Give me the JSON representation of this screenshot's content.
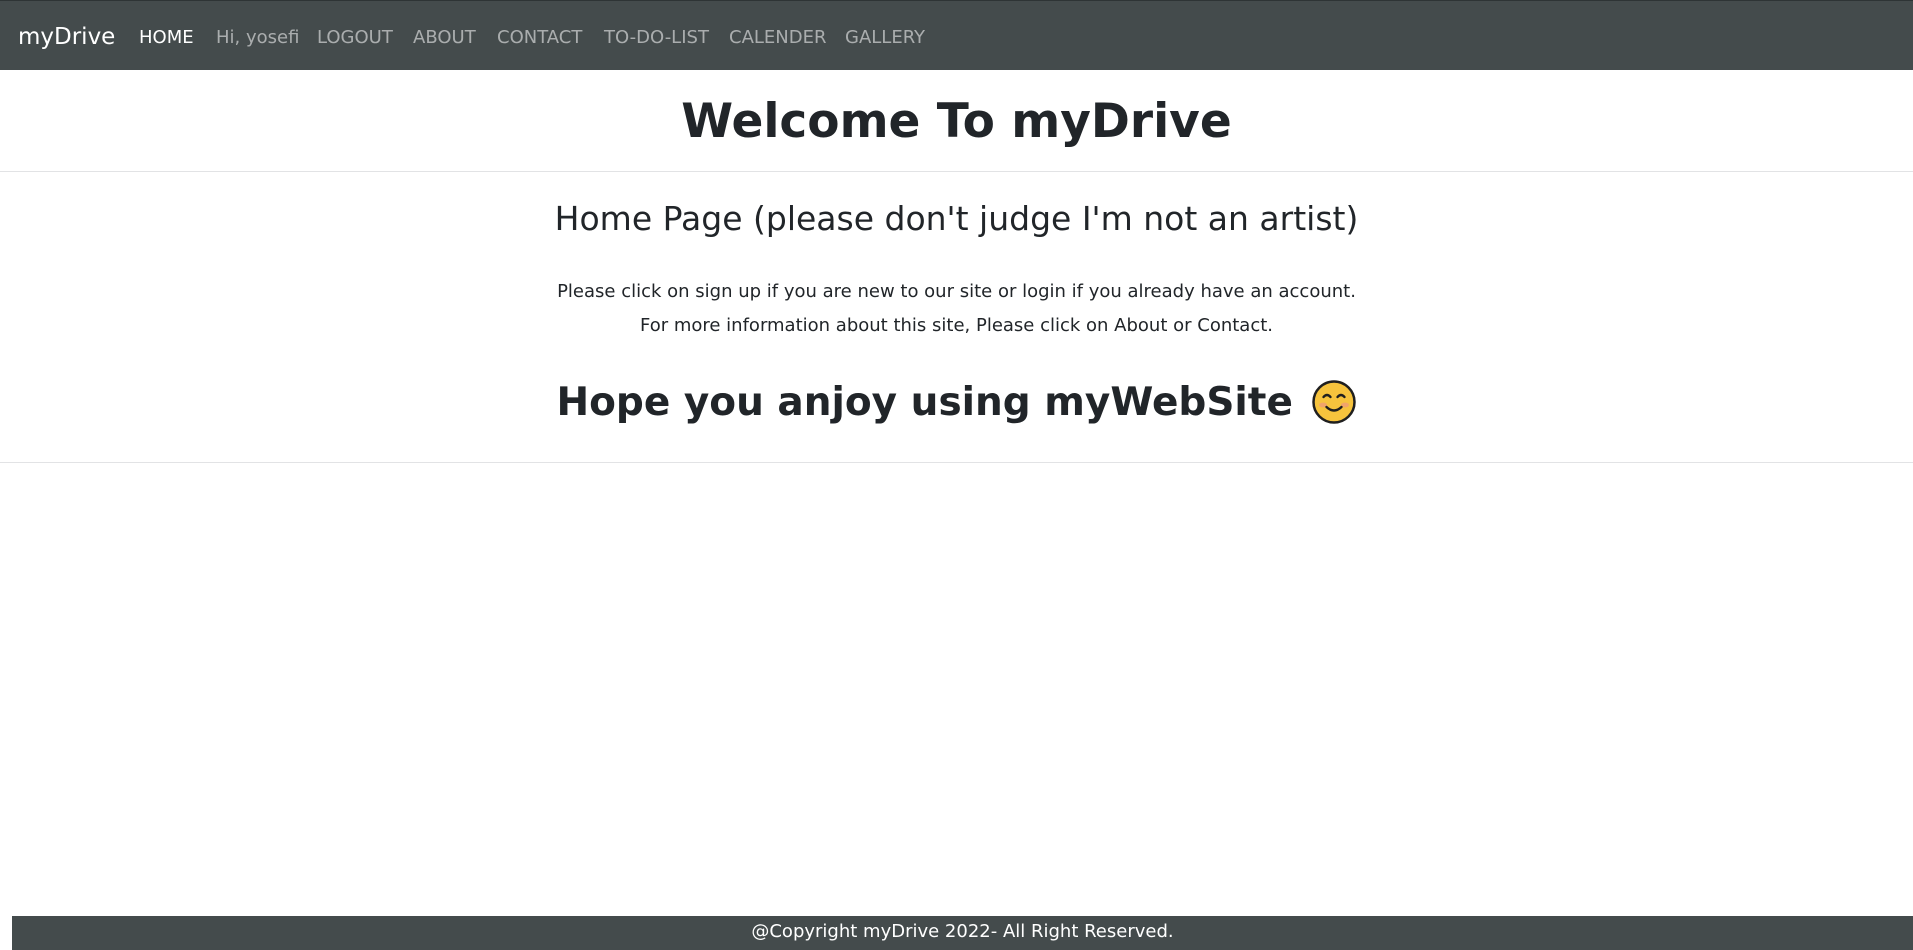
{
  "navbar": {
    "brand": "myDrive",
    "items": [
      {
        "label": "HOME",
        "active": true
      },
      {
        "label": "Hi, yosefi",
        "active": false
      },
      {
        "label": "LOGOUT",
        "active": false
      },
      {
        "label": "ABOUT",
        "active": false
      },
      {
        "label": "CONTACT",
        "active": false
      },
      {
        "label": "TO-DO-LIST",
        "active": false
      },
      {
        "label": "CALENDER",
        "active": false
      },
      {
        "label": "GALLERY",
        "active": false
      }
    ],
    "background_color": "#444b4c"
  },
  "main": {
    "title": "Welcome To myDrive",
    "subtitle": "Home Page (please don't judge I'm not an artist)",
    "line1": "Please click on sign up if you are new to our site or login if you already have an account.",
    "line2": "For more information about this site, Please click on About or Contact.",
    "closing": "Hope you anjoy using myWebSite",
    "closing_icon": "smiling-face-emoji-icon"
  },
  "footer": {
    "text": "@Copyright myDrive 2022- All Right Reserved."
  }
}
